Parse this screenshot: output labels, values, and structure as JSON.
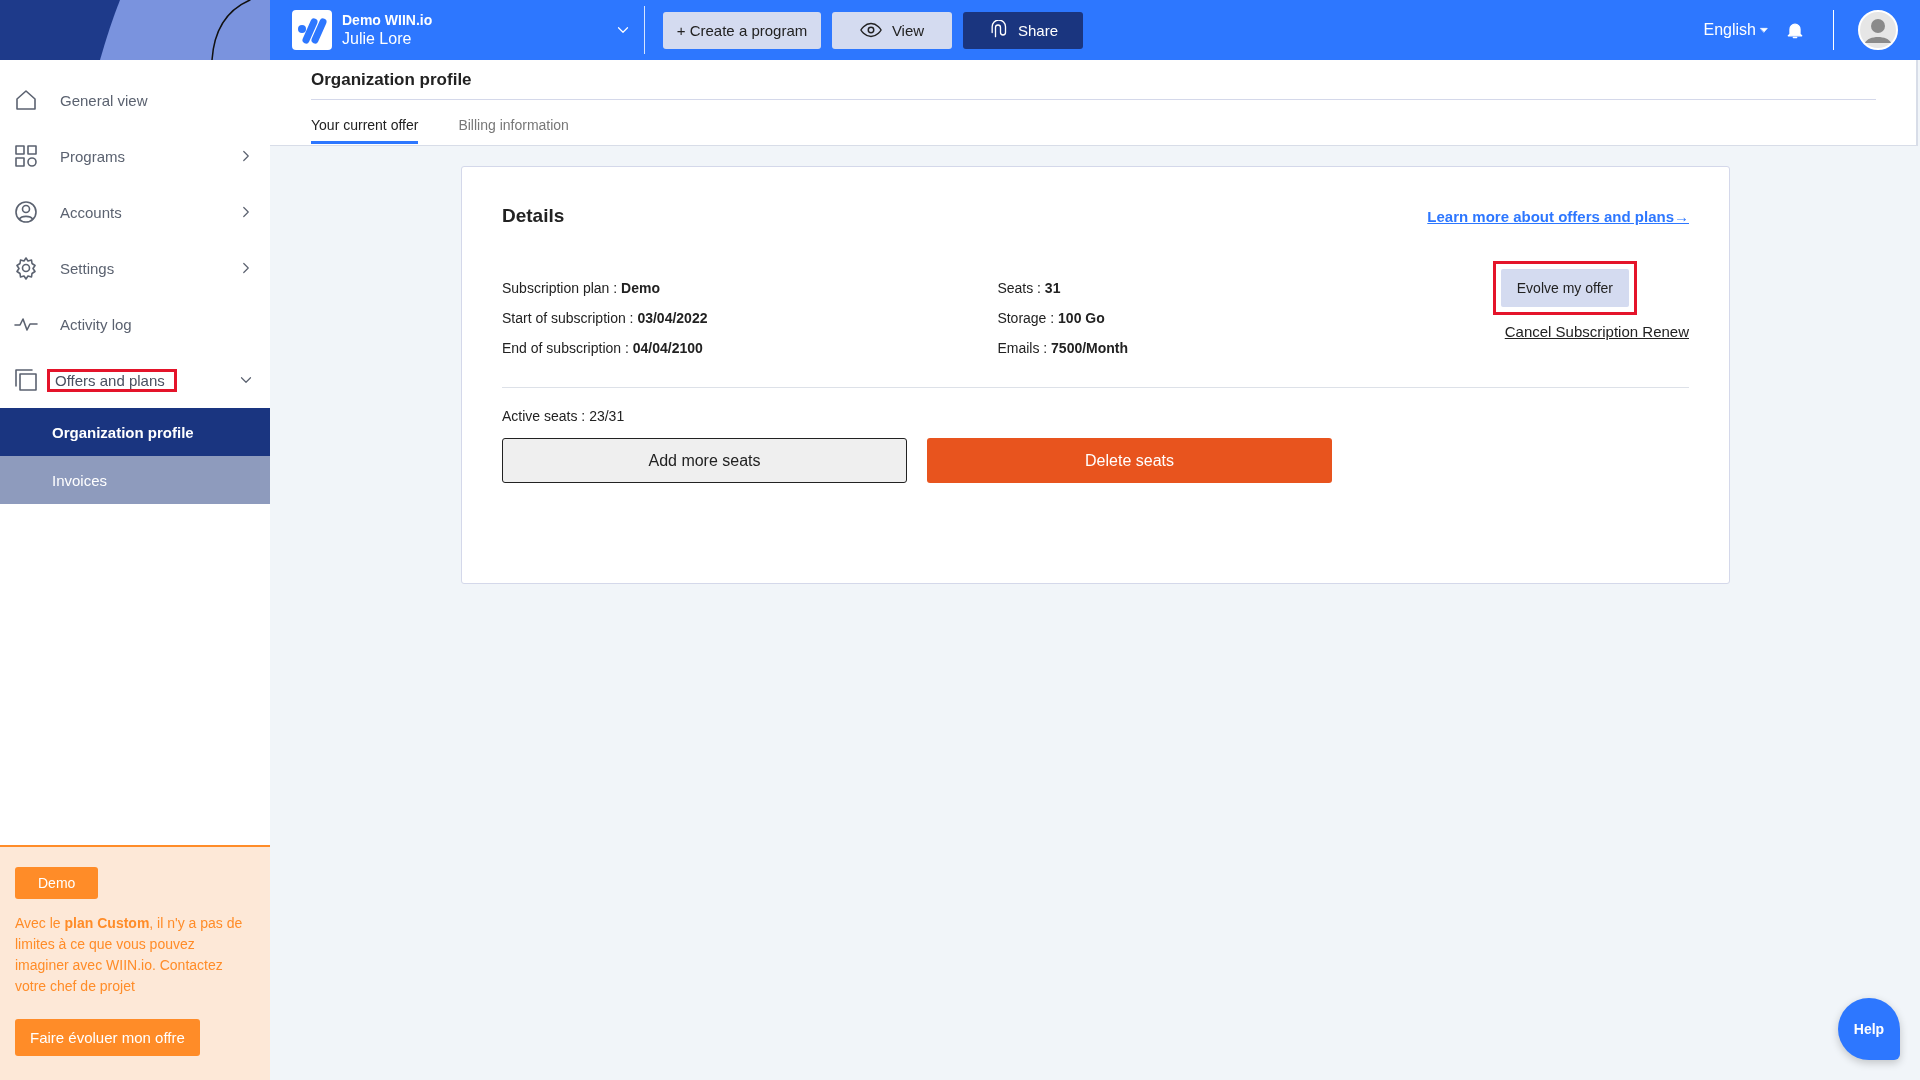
{
  "org_switcher": {
    "name": "Demo WIIN.io",
    "user": "Julie Lore"
  },
  "toolbar": [
    {
      "label": "+ Create a program",
      "kind": "light"
    },
    {
      "label": "View",
      "kind": "view"
    },
    {
      "label": "Share",
      "kind": "dark"
    }
  ],
  "language": "English",
  "sidebar": {
    "items": [
      {
        "label": "General view"
      },
      {
        "label": "Programs",
        "expanded": false
      },
      {
        "label": "Accounts",
        "expanded": false
      },
      {
        "label": "Settings",
        "expanded": false
      },
      {
        "label": "Activity log"
      },
      {
        "label": "Offers and plans",
        "expanded": true,
        "highlighted": true,
        "children": [
          {
            "label": "Organization profile",
            "selected": true
          },
          {
            "label": "Invoices",
            "selected": false
          }
        ]
      }
    ]
  },
  "plan_panel": {
    "badge": "Demo",
    "text": "Avec le **plan Custom**, il n'y a pas de limites à ce que vous pouvez imaginer avec WIIN.io. Contactez votre chef de projet",
    "button": "Faire évoluer mon offre"
  },
  "page": {
    "title": "Organization profile",
    "tabs": [
      {
        "label": "Your current offer",
        "selected": true
      },
      {
        "label": "Billing information",
        "selected": false
      }
    ]
  },
  "details": {
    "title": "Details",
    "link": "Learn more about offers and plans→",
    "left": [
      {
        "label": "Subscription plan : ",
        "value": "Demo"
      },
      {
        "label": "Start of subscription : ",
        "value": "03/04/2022"
      },
      {
        "label": "End of subscription : ",
        "value": "04/04/2100"
      }
    ],
    "right": [
      {
        "label": "Seats : ",
        "value": "31"
      },
      {
        "label": "Storage : ",
        "value": "100 Go"
      },
      {
        "label": "Emails : ",
        "value": "7500/Month"
      }
    ],
    "evolve_button": {
      "label": "Evolve my offer",
      "highlighted": true
    },
    "cancel_link": "Cancel Subscription Renew",
    "active_seats": "Active seats : 23/31",
    "add_button": "Add more seats",
    "delete_button": "Delete seats"
  },
  "help_button": "Help"
}
